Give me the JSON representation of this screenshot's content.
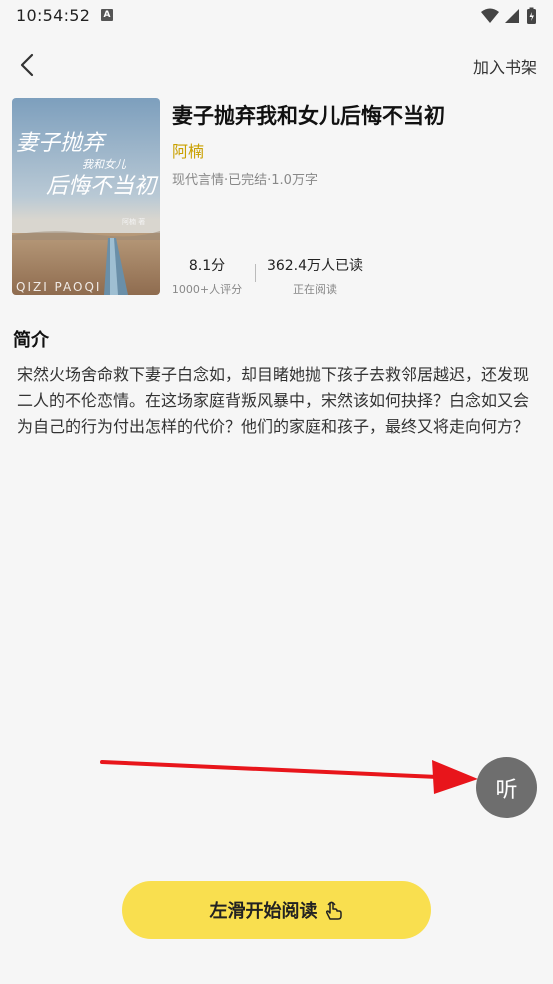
{
  "status_bar": {
    "time": "10:54:52",
    "notification_badge": "A",
    "icons": [
      "wifi-icon",
      "signal-icon",
      "battery-icon"
    ]
  },
  "nav": {
    "back_icon": "chevron-left-icon",
    "add_to_shelf_label": "加入书架"
  },
  "book": {
    "title": "妻子抛弃我和女儿后悔不当初",
    "author": "阿楠",
    "meta": "现代言情·已完结·1.0万字",
    "cover": {
      "title_art": "妻子抛弃我和女儿后悔不当初",
      "author_art": "阿楠 著",
      "series_art": "QIZI PAOQI"
    },
    "score": {
      "value": "8.1分",
      "label": "1000+人评分"
    },
    "readers": {
      "value": "362.4万人已读",
      "label": "正在阅读"
    }
  },
  "intro": {
    "heading": "简介",
    "text": "宋然火场舍命救下妻子白念如，却目睹她抛下孩子去救邻居越迟，还发现二人的不伦恋情。在这场家庭背叛风暴中，宋然该如何抉择？白念如又会为自己的行为付出怎样的代价？他们的家庭和孩子，最终又将走向何方？"
  },
  "listen_button": {
    "label": "听"
  },
  "read_button": {
    "label": "左滑开始阅读",
    "icon": "hand-swipe-icon"
  },
  "colors": {
    "background": "#f6f6f6",
    "author_accent": "#c9a000",
    "read_button": "#f9df4f",
    "listen_button": "#6e6e6e",
    "annotation_arrow": "#e8151b"
  }
}
